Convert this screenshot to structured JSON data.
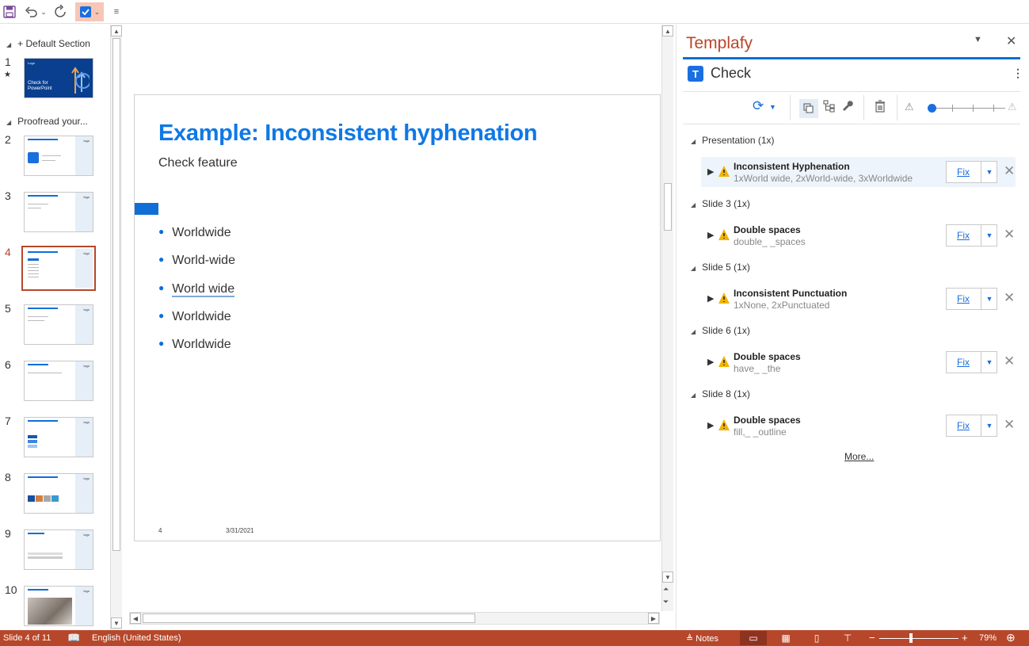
{
  "qat": {
    "save_icon": "save-icon",
    "undo_icon": "undo-icon",
    "redo_icon": "redo-icon",
    "check_icon": "checkbox-icon",
    "customize_icon": "customize-qat-icon"
  },
  "thumbnails": {
    "sections": [
      {
        "label": "Default Section",
        "prefix": "+ "
      },
      {
        "label": "Proofread your...",
        "prefix": ""
      }
    ],
    "slides": [
      {
        "num": "1",
        "text": "Check for PowerPoint",
        "logo": "Logo"
      },
      {
        "num": "2",
        "logo": "logo"
      },
      {
        "num": "3",
        "logo": "logo"
      },
      {
        "num": "4",
        "logo": "logo"
      },
      {
        "num": "5",
        "logo": "logo"
      },
      {
        "num": "6",
        "logo": "logo"
      },
      {
        "num": "7",
        "logo": "logo"
      },
      {
        "num": "8",
        "logo": "logo"
      },
      {
        "num": "9",
        "logo": "logo"
      },
      {
        "num": "10",
        "logo": "logo"
      }
    ],
    "current": "4"
  },
  "slide": {
    "title": "Example: Inconsistent hyphenation",
    "subtitle": "Check feature",
    "bullets": [
      "Worldwide",
      "World-wide",
      "World wide",
      "Worldwide",
      "Worldwide"
    ],
    "footer_num": "4",
    "footer_date": "3/31/2021"
  },
  "pane": {
    "title": "Templafy",
    "check_badge": "T",
    "check_label": "Check",
    "groups": [
      {
        "label": "Presentation (1x)",
        "issues": [
          {
            "title": "Inconsistent Hyphenation",
            "detail": "1xWorld wide, 2xWorld-wide, 3xWorldwide",
            "selected": true
          }
        ]
      },
      {
        "label": "Slide 3 (1x)",
        "issues": [
          {
            "title": "Double spaces",
            "detail": "double_ _spaces",
            "selected": false
          }
        ]
      },
      {
        "label": "Slide 5 (1x)",
        "issues": [
          {
            "title": "Inconsistent Punctuation",
            "detail": "1xNone, 2xPunctuated",
            "selected": false
          }
        ]
      },
      {
        "label": "Slide 6 (1x)",
        "issues": [
          {
            "title": "Double spaces",
            "detail": "have_ _the",
            "selected": false
          }
        ]
      },
      {
        "label": "Slide 8 (1x)",
        "issues": [
          {
            "title": "Double spaces",
            "detail": "fill,_ _outline",
            "selected": false
          }
        ]
      }
    ],
    "fix_label": "Fix",
    "more_label": "More..."
  },
  "status": {
    "slide_info": "Slide 4 of 11",
    "language": "English (United States)",
    "notes_label": "Notes",
    "zoom": "79%"
  },
  "colors": {
    "accent": "#b7472a",
    "brand_blue": "#0f78e6",
    "status_bar": "#b7472a"
  }
}
